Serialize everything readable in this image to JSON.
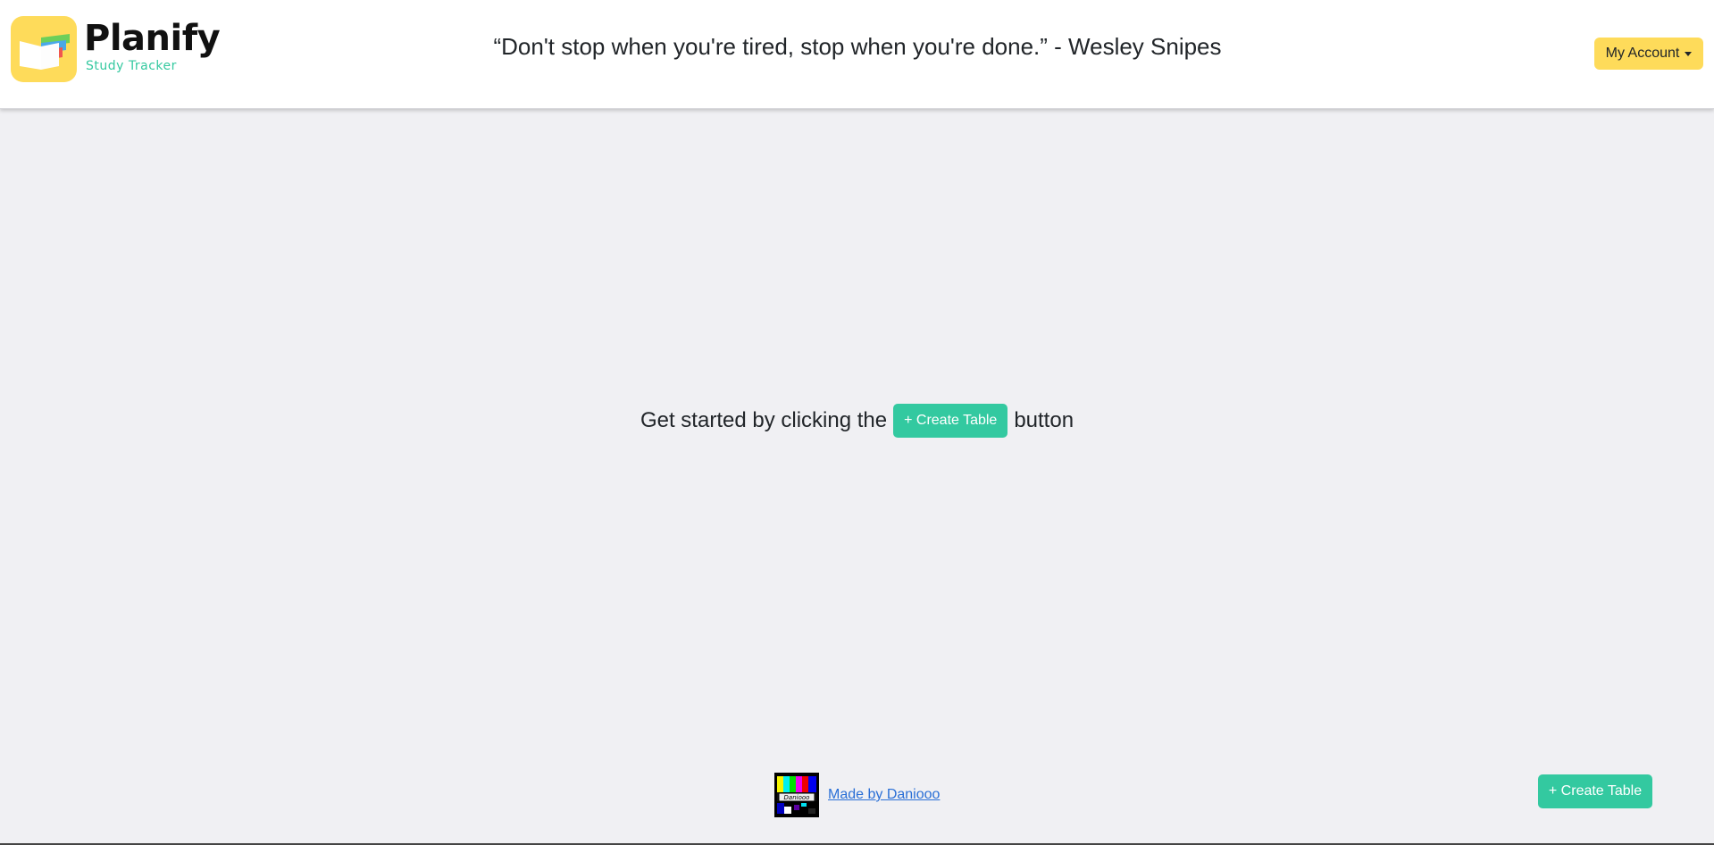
{
  "header": {
    "brand_name": "Planify",
    "brand_tagline": "Study Tracker",
    "quote": "“Don't stop when you're tired, stop when you're done.” - Wesley Snipes",
    "account_button": "My Account",
    "logo_icon": "open-book-icon"
  },
  "main": {
    "prefix": "Get started by clicking the",
    "create_button": "+ Create Table",
    "suffix": "button"
  },
  "footer": {
    "avatar_text": "Daniooo",
    "link_text": "Made by Daniooo"
  },
  "floating": {
    "create_button": "+ Create Table"
  },
  "colors": {
    "accent_yellow": "#fedb5a",
    "accent_green": "#33c9a0",
    "link_blue": "#2a6fd6",
    "background": "#f0f0f3"
  }
}
